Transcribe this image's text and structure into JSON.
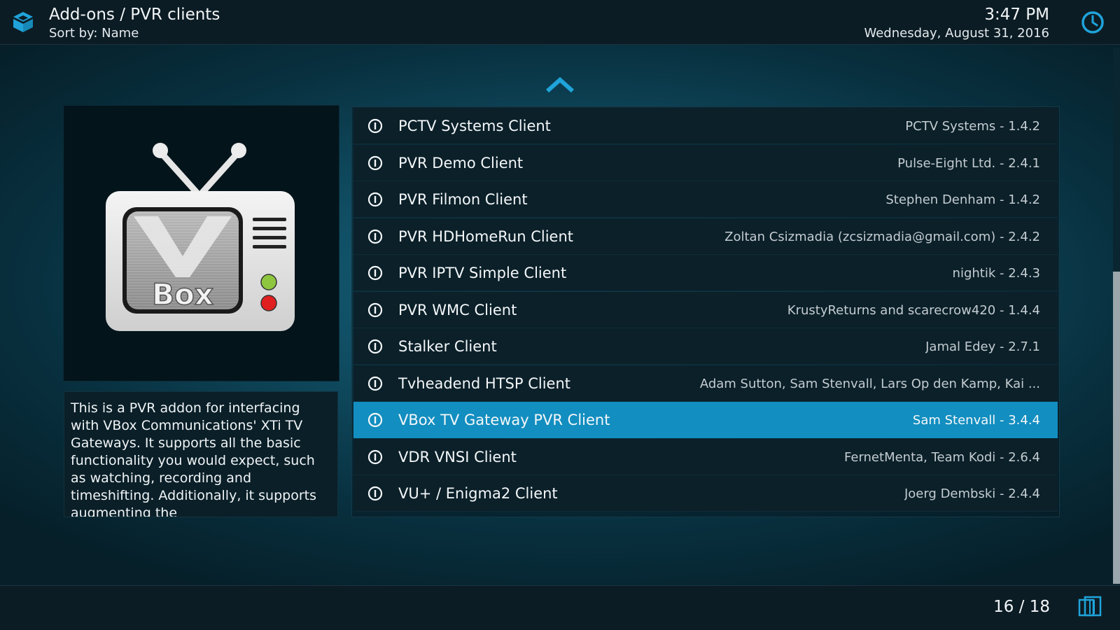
{
  "header": {
    "title": "Add-ons / PVR clients",
    "sort": "Sort by: Name",
    "time": "3:47 PM",
    "date": "Wednesday, August 31, 2016",
    "addon_icon": "addons-box-icon",
    "clock_icon": "clock-icon"
  },
  "thumbnail": {
    "logo_text": "Box",
    "icon": "vbox-tv-logo"
  },
  "description": "This is a PVR addon for interfacing with VBox Communications' XTi TV Gateways. It supports all the basic functionality you would expect, such as watching, recording and timeshifting. Additionally, it supports augmenting the",
  "list": {
    "items": [
      {
        "name": "PCTV Systems Client",
        "meta": "PCTV Systems - 1.4.2"
      },
      {
        "name": "PVR Demo Client",
        "meta": "Pulse-Eight Ltd. - 2.4.1"
      },
      {
        "name": "PVR Filmon Client",
        "meta": "Stephen Denham - 1.4.2"
      },
      {
        "name": "PVR HDHomeRun Client",
        "meta": "Zoltan Csizmadia (zcsizmadia@gmail.com) - 2.4.2"
      },
      {
        "name": "PVR IPTV Simple Client",
        "meta": "nightik - 2.4.3"
      },
      {
        "name": "PVR WMC Client",
        "meta": "KrustyReturns and scarecrow420 - 1.4.4"
      },
      {
        "name": "Stalker Client",
        "meta": "Jamal Edey - 2.7.1"
      },
      {
        "name": "Tvheadend HTSP Client",
        "meta": "Adam Sutton, Sam Stenvall, Lars Op den Kamp, Kai ..."
      },
      {
        "name": "VBox TV Gateway PVR Client",
        "meta": "Sam Stenvall - 3.4.4"
      },
      {
        "name": "VDR VNSI Client",
        "meta": "FernetMenta, Team Kodi - 2.6.4"
      },
      {
        "name": "VU+ / Enigma2 Client",
        "meta": "Joerg Dembski - 2.4.4"
      }
    ],
    "selected_index": 8,
    "item_icon": "power-icon"
  },
  "footer": {
    "counter": "16 / 18",
    "view_icon": "view-mode-icon"
  },
  "colors": {
    "accent": "#128ec0",
    "bar": "#0c1c24",
    "icon_blue": "#1fa3d9"
  }
}
